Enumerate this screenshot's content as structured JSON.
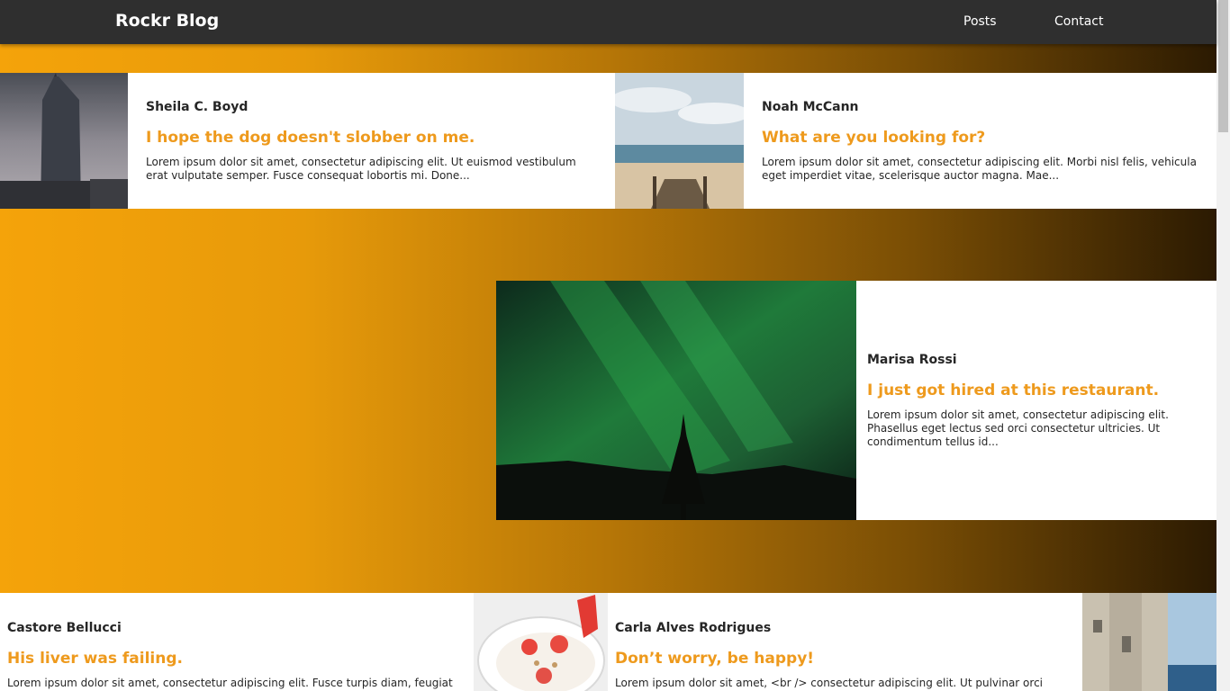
{
  "navbar": {
    "brand": "Rockr Blog",
    "links": [
      "Posts",
      "Contact"
    ]
  },
  "posts": [
    {
      "author": "Sheila C. Boyd",
      "title": "I hope the dog doesn't slobber on me.",
      "excerpt": "Lorem ipsum dolor sit amet, consectetur adipiscing elit. Ut euismod vestibulum erat vulputate semper. Fusce consequat lobortis mi. Done...",
      "image": "skyscraper-photo"
    },
    {
      "author": "Noah McCann",
      "title": "What are you looking for?",
      "excerpt": "Lorem ipsum dolor sit amet, consectetur adipiscing elit. Morbi nisl felis, vehicula eget imperdiet vitae, scelerisque auctor magna. Mae...",
      "image": "beach-boardwalk-photo"
    },
    {
      "author": "Marisa Rossi",
      "title": "I just got hired at this restaurant.",
      "excerpt": "Lorem ipsum dolor sit amet, consectetur adipiscing elit. Phasellus eget lectus sed orci consectetur ultricies. Ut condimentum tellus id...",
      "image": "northern-lights-photo"
    },
    {
      "author": "Castore Bellucci",
      "title": "His liver was failing.",
      "excerpt": "Lorem ipsum dolor sit amet, consectetur adipiscing elit. Fusce turpis diam, feugiat",
      "image": ""
    },
    {
      "author": "Carla Alves Rodrigues",
      "title": "Don’t worry, be happy!",
      "excerpt": "Lorem ipsum dolor sit amet, <br /> consectetur adipiscing elit. Ut pulvinar orci vitae",
      "image": "yogurt-strawberry-bowl-photo"
    }
  ],
  "colors": {
    "navbar": "#2f2f2f",
    "accent": "#ee9a1d",
    "gradient_start": "#f5a30a",
    "gradient_end": "#2b1a02"
  }
}
